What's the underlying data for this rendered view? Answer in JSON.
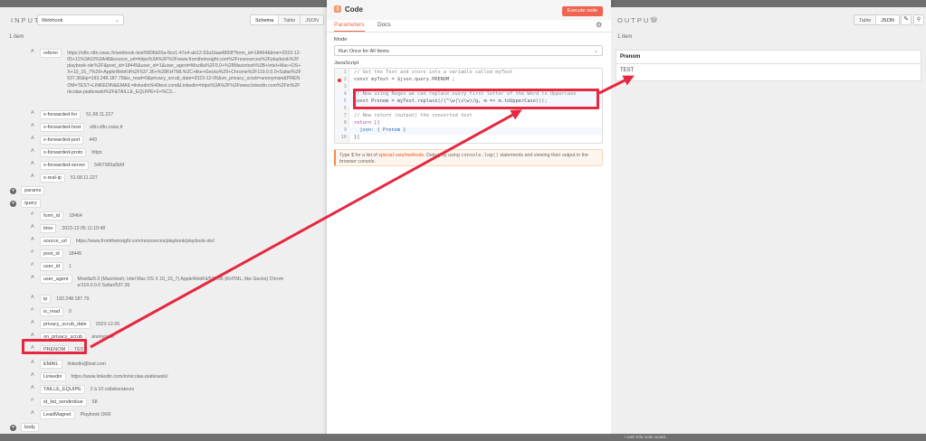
{
  "input": {
    "title": "INPUT",
    "source_select": "Webhook",
    "tabs": [
      "Schema",
      "Table",
      "JSON"
    ],
    "item_count": "1 item",
    "rows": [
      {
        "type": "A",
        "key": "referer",
        "value": "https://n8n.n8n.cwac.fr/webhook-test/5806b00a-8ce1-47e4-ab12-53a1baa4899f?form_id=18464&time=2023-12-05+11%3A10%3A48&source_url=https%3A%2F%2Fwww.fromtheinsight.com%2Fressources%2Fplaybook%2Fplaybook-okr%2F&post_id=18445&user_id=1&user_agent=Mozilla%2F5.0+%28Macintosh%3B+Intel+Mac+OS+X+10_15_7%29+AppleWebKit%2F537.36+%28KHTML%2C+like+Gecko%29+Chrome%2F119.0.0.0+Safari%2F537.36&ip=193.248.187.79&is_read=0&privacy_scrub_date=2023-12-05&on_privacy_scrub=anonymize&PRENOM=TEST+LINKEDIN&EMAIL=linkedin%40test.com&Linkedin=https%3A%2F%2Fwww.linkedin.com%2Fin%2Fnicolas-piatkowski%2F&TAILLE_EQUIPE=2+%C3..."
      },
      {
        "type": "A",
        "key": "x-forwarded-for",
        "value": "51.68.11.227"
      },
      {
        "type": "A",
        "key": "x-forwarded-host",
        "value": "n8n.n8n.cwac.fr"
      },
      {
        "type": "A",
        "key": "x-forwarded-port",
        "value": "443"
      },
      {
        "type": "A",
        "key": "x-forwarded-proto",
        "value": "https"
      },
      {
        "type": "A",
        "key": "x-forwarded-server",
        "value": "5467965a5b6f"
      },
      {
        "type": "A",
        "key": "x-real-ip",
        "value": "51.68.11.227"
      }
    ],
    "params_label": "params",
    "query_label": "query",
    "query_rows": [
      {
        "type": "#",
        "key": "form_id",
        "value": "18464"
      },
      {
        "type": "A",
        "key": "time",
        "value": "2023-12-05 11:10:48"
      },
      {
        "type": "A",
        "key": "source_url",
        "value": "https://www.fromtheinsight.com/ressources/playbook/playbook-okr/"
      },
      {
        "type": "#",
        "key": "post_id",
        "value": "18445"
      },
      {
        "type": "#",
        "key": "user_id",
        "value": "1"
      },
      {
        "type": "A",
        "key": "user_agent",
        "value": "Mozilla/5.0 (Macintosh; Intel Mac OS X 10_15_7) AppleWebKit/537.36 (KHTML, like Gecko) Chrome/119.0.0.0 Safari/537.36"
      },
      {
        "type": "A",
        "key": "ip",
        "value": "193.248.187.79"
      },
      {
        "type": "#",
        "key": "is_read",
        "value": "0"
      },
      {
        "type": "A",
        "key": "privacy_scrub_date",
        "value": "2023-12-05"
      },
      {
        "type": "A",
        "key": "on_privacy_scrub",
        "value": "anonymize"
      },
      {
        "type": "A",
        "key": "PRENOM",
        "value": "TEST"
      },
      {
        "type": "A",
        "key": "EMAIL",
        "value": "linkedin@test.com"
      },
      {
        "type": "A",
        "key": "Linkedin",
        "value": "https://www.linkedin.com/in/nicolas-piatkowski/"
      },
      {
        "type": "A",
        "key": "TAILLE_EQUIPE",
        "value": "2 à 10 collaborateurs"
      },
      {
        "type": "#",
        "key": "id_list_sendinblue",
        "value": "58"
      },
      {
        "type": "A",
        "key": "LeadMagnet",
        "value": "Playbook OKR"
      }
    ],
    "body_label": "body"
  },
  "code_node": {
    "title": "Code",
    "execute_label": "Execute node",
    "tabs": [
      "Parameters",
      "Docs"
    ],
    "mode_label": "Mode",
    "mode_value": "Run Once for All Items",
    "language_label": "JavaScript",
    "code_lines": [
      "// Get the Text and store into a variable called myText",
      "const myText = $json.query.PRENOM ;",
      "",
      "// Now using Regex we can replace every first letter of the Word to Uppercase",
      "const Prenom = myText.replace(/(^\\w|\\s\\w)/g, m => m.toUpperCase());",
      "",
      "// Now return (output) the converted text",
      "return [{",
      "  json: { Prenom }",
      "}]"
    ],
    "line_numbers": [
      "1",
      "2",
      "3",
      "4",
      "5",
      "6",
      "7",
      "8",
      "9",
      "10"
    ],
    "tip_prefix": "Type $ for a list of ",
    "tip_link": "special vars/methods",
    "tip_middle": ". Debug by using ",
    "tip_code": "console.log()",
    "tip_suffix": " statements and viewing their output in the browser console."
  },
  "output": {
    "title": "OUTPUT",
    "tabs": [
      "Table",
      "JSON"
    ],
    "item_count": "1 item",
    "column_header": "Prenom",
    "cell_value": "TEST"
  },
  "footer": {
    "pin_hint": "I wish this node would..."
  },
  "colors": {
    "accent": "#e8694a",
    "highlight": "#e5273f"
  }
}
